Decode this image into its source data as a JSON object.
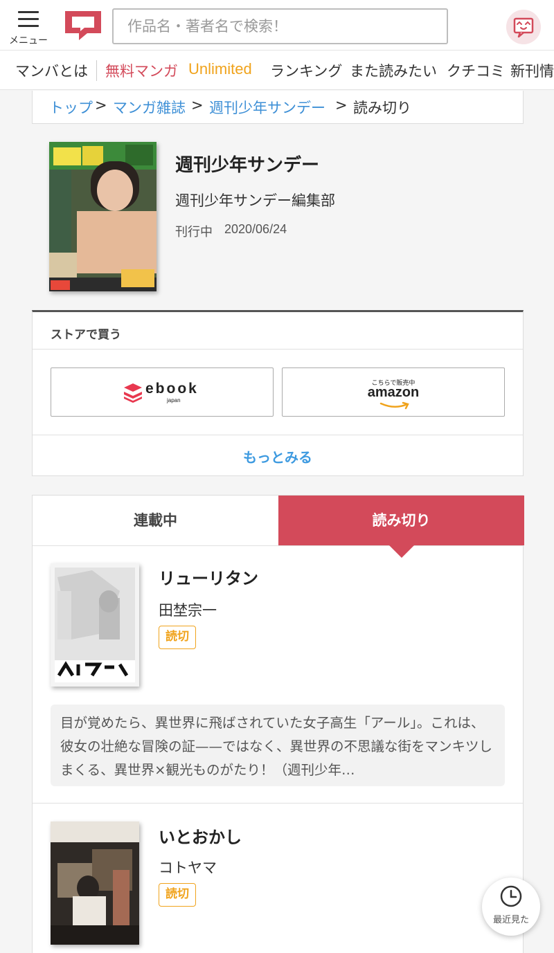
{
  "header": {
    "menu_label": "メニュー",
    "search_placeholder": "作品名・著者名で検索！",
    "brand_color": "#d34a5a"
  },
  "nav": {
    "items": [
      "マンバとは",
      "無料マンガ",
      "Unlimited",
      "ランキング",
      "また読みたい",
      "クチコミ",
      "新刊情"
    ]
  },
  "breadcrumb": {
    "items": [
      "トップ",
      "マンガ雑誌",
      "週刊少年サンデー",
      "読み切り"
    ],
    "separator": ">"
  },
  "magazine": {
    "title": "週刊少年サンデー",
    "publisher": "週刊少年サンデー編集部",
    "status": "刊行中",
    "date": "2020/06/24"
  },
  "store": {
    "title": "ストアで買う",
    "ebook_label": "ebook",
    "ebook_sub": "japan",
    "amazon_sub": "こちらで販売中",
    "amazon_label": "amazon",
    "more_label": "もっとみる"
  },
  "tabs": {
    "ongoing": "連載中",
    "oneshot": "読み切り",
    "active": "oneshot"
  },
  "works": [
    {
      "title": "リューリタン",
      "author": "田埜宗一",
      "badge": "読切",
      "description": "目が覚めたら、異世界に飛ばされていた女子高生「アール」。これは、彼女の壮絶な冒険の証——ではなく、異世界の不思議な街をマンキツしまくる、異世界×観光ものがたり！（週刊少年…"
    },
    {
      "title": "いとおかし",
      "author": "コトヤマ",
      "badge": "読切"
    }
  ],
  "recent": {
    "label": "最近見た"
  }
}
